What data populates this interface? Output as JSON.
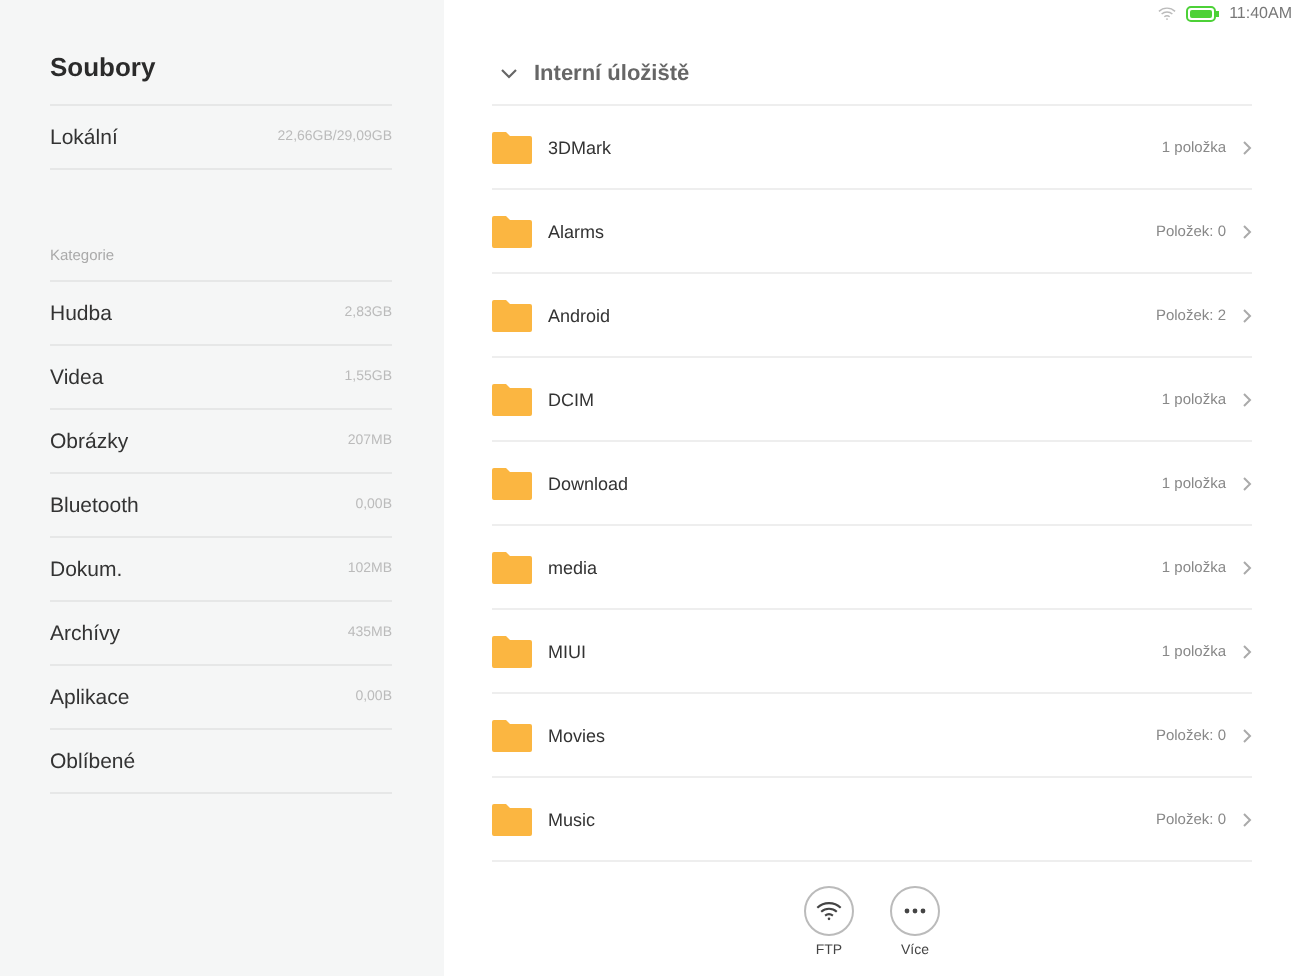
{
  "status_bar": {
    "time": "11:40AM"
  },
  "sidebar": {
    "title": "Soubory",
    "storage": {
      "label": "Lokální",
      "value": "22,66GB/29,09GB"
    },
    "section_label": "Kategorie",
    "items": [
      {
        "label": "Hudba",
        "value": "2,83GB"
      },
      {
        "label": "Videa",
        "value": "1,55GB"
      },
      {
        "label": "Obrázky",
        "value": "207MB"
      },
      {
        "label": "Bluetooth",
        "value": "0,00B"
      },
      {
        "label": "Dokum.",
        "value": "102MB"
      },
      {
        "label": "Archívy",
        "value": "435MB"
      },
      {
        "label": "Aplikace",
        "value": "0,00B"
      },
      {
        "label": "Oblíbené"
      }
    ]
  },
  "main": {
    "header": {
      "title": "Interní úložiště",
      "expanded": true
    },
    "folders": [
      {
        "name": "3DMark",
        "count": "1 položka"
      },
      {
        "name": "Alarms",
        "count": "Položek: 0"
      },
      {
        "name": "Android",
        "count": "Položek: 2"
      },
      {
        "name": "DCIM",
        "count": "1 položka"
      },
      {
        "name": "Download",
        "count": "1 položka"
      },
      {
        "name": "media",
        "count": "1 položka"
      },
      {
        "name": "MIUI",
        "count": "1 položka"
      },
      {
        "name": "Movies",
        "count": "Položek: 0"
      },
      {
        "name": "Music",
        "count": "Položek: 0"
      }
    ],
    "actions": [
      {
        "kind": "wifi",
        "label": "FTP"
      },
      {
        "kind": "more",
        "label": "Více"
      }
    ]
  }
}
